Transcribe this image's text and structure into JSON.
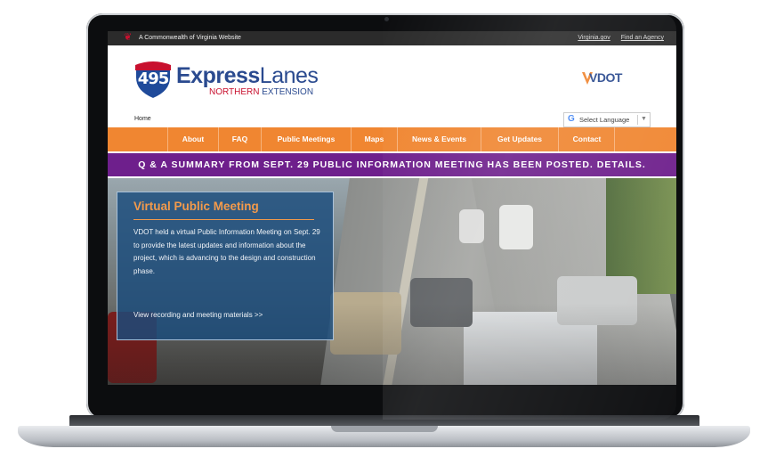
{
  "gov_bar": {
    "text": "A Commonwealth of Virginia Website",
    "links": [
      "Virginia.gov",
      "Find an Agency"
    ]
  },
  "logo": {
    "shield_number": "495",
    "brand_bold": "Express",
    "brand_light": "Lanes",
    "subtitle_red": "NORTHERN",
    "subtitle_blue": "EXTENSION"
  },
  "vdot_logo": "VDOT",
  "breadcrumb": "Home",
  "language": {
    "g": "G",
    "label": "Select Language"
  },
  "nav": {
    "items": [
      "About",
      "FAQ",
      "Public Meetings",
      "Maps",
      "News & Events",
      "Get Updates",
      "Contact"
    ]
  },
  "announcement": "Q & A SUMMARY FROM SEPT. 29 PUBLIC INFORMATION MEETING HAS BEEN POSTED. DETAILS.",
  "hero": {
    "title": "Virtual Public Meeting",
    "body": "VDOT held a virtual Public Information Meeting on Sept. 29 to provide the latest updates and information about the project, which is advancing to the design and construction phase.",
    "link": "View recording and meeting materials >>"
  },
  "colors": {
    "nav_orange": "#f08631",
    "announce_purple": "#6e1f8c",
    "brand_blue": "#2a4a8f",
    "brand_red": "#c8102e",
    "info_box": "#1a4c7d"
  }
}
